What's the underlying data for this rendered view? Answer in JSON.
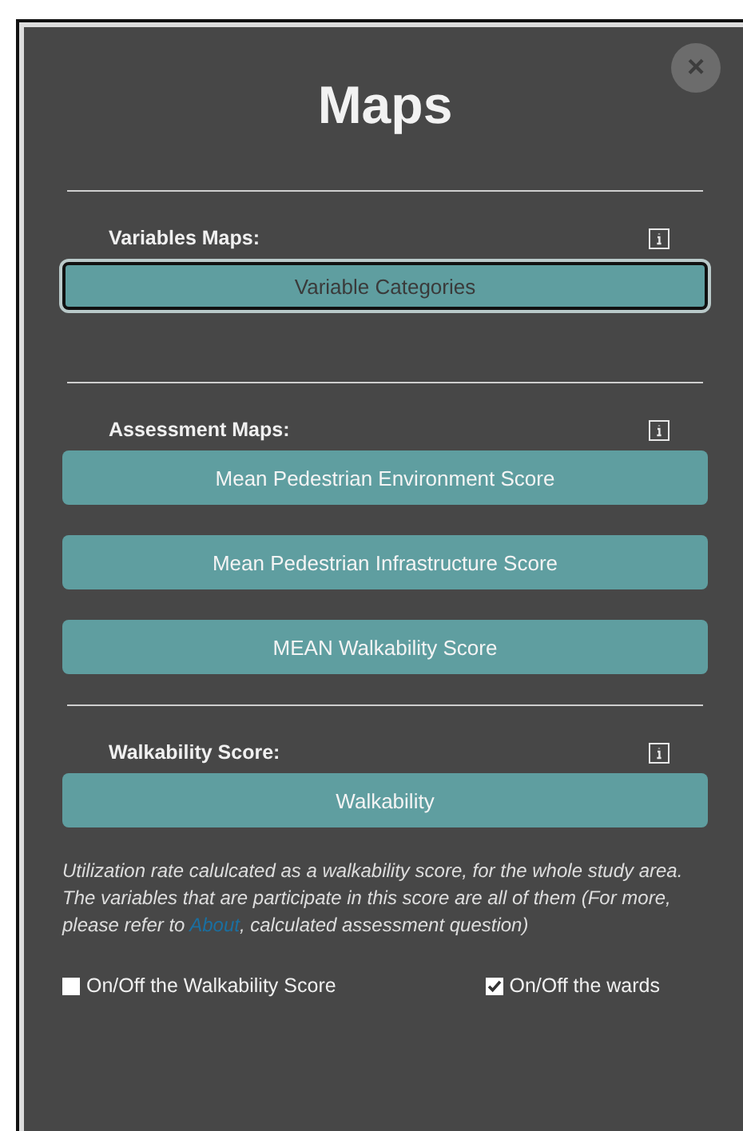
{
  "dialog": {
    "title": "Maps",
    "close": "×"
  },
  "sections": [
    {
      "label": "Variables Maps:",
      "buttons": [
        {
          "label": "Variable Categories",
          "selected": true
        }
      ]
    },
    {
      "label": "Assessment Maps:",
      "buttons": [
        {
          "label": "Mean Pedestrian Environment Score",
          "selected": false
        },
        {
          "label": "Mean Pedestrian Infrastructure Score",
          "selected": false
        },
        {
          "label": "MEAN Walkability Score",
          "selected": false
        }
      ]
    },
    {
      "label": "Walkability Score:",
      "buttons": [
        {
          "label": "Walkability",
          "selected": false
        }
      ]
    }
  ],
  "note": {
    "before": "Utilization rate calulcated as a walkability score, for the whole study area. The variables that are participate in this score are all of them (For more, please refer to ",
    "link": "About",
    "after": ", calculated assessment question)"
  },
  "toggles": [
    {
      "label": "On/Off the Walkability Score",
      "checked": false
    },
    {
      "label": "On/Off the wards",
      "checked": true
    }
  ]
}
